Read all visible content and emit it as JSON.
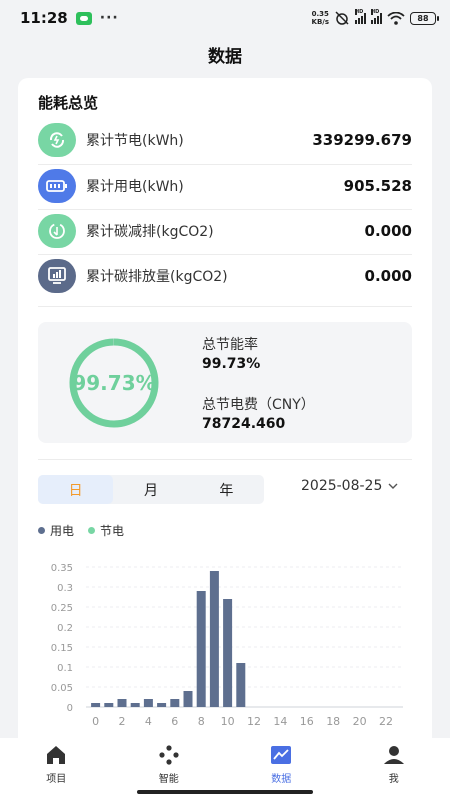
{
  "status_bar": {
    "time": "11:28",
    "more": "···",
    "net_speed_value": "0.35",
    "net_speed_unit": "KB/s",
    "signal_tag": "HD",
    "battery": "88"
  },
  "page_title": "数据",
  "overview": {
    "title": "能耗总览",
    "metrics": [
      {
        "label": "累计节电(kWh)",
        "value": "339299.679",
        "icon": "energy-save-icon",
        "color": "#78d6a4"
      },
      {
        "label": "累计用电(kWh)",
        "value": "905.528",
        "icon": "battery-icon",
        "color": "#4f7ae8"
      },
      {
        "label": "累计碳减排(kgCO2)",
        "value": "0.000",
        "icon": "carbon-reduce-icon",
        "color": "#78d6a4"
      },
      {
        "label": "累计碳排放量(kgCO2)",
        "value": "0.000",
        "icon": "carbon-emission-icon",
        "color": "#5b6a8a"
      }
    ]
  },
  "summary": {
    "ring_value": 0.9973,
    "ring_text": "99.73%",
    "ring_color": "#6fd09c",
    "saving_rate_label": "总节能率",
    "saving_rate_value": "99.73%",
    "saving_fee_label": "总节电费（CNY）",
    "saving_fee_value": "78724.460"
  },
  "period_tabs": [
    {
      "label": "日",
      "active": true
    },
    {
      "label": "月",
      "active": false
    },
    {
      "label": "年",
      "active": false
    }
  ],
  "date": "2025-08-25",
  "legend": [
    {
      "label": "用电",
      "color": "#5e6f8f"
    },
    {
      "label": "节电",
      "color": "#78d6a4"
    }
  ],
  "chart_data": {
    "type": "bar",
    "xlabel": "",
    "ylabel": "",
    "ylim": [
      0,
      0.35
    ],
    "y_ticks": [
      "0",
      "0.05",
      "0.1",
      "0.15",
      "0.2",
      "0.25",
      "0.3",
      "0.35"
    ],
    "x_ticks": [
      "0",
      "2",
      "4",
      "6",
      "8",
      "10",
      "12",
      "14",
      "16",
      "18",
      "20",
      "22"
    ],
    "categories": [
      0,
      1,
      2,
      3,
      4,
      5,
      6,
      7,
      8,
      9,
      10,
      11,
      12,
      13,
      14,
      15,
      16,
      17,
      18,
      19,
      20,
      21,
      22,
      23
    ],
    "series": [
      {
        "name": "用电",
        "color": "#5e6f8f",
        "values": [
          0.01,
          0.01,
          0.02,
          0.01,
          0.02,
          0.01,
          0.02,
          0.04,
          0.29,
          0.34,
          0.27,
          0.11,
          0,
          0,
          0,
          0,
          0,
          0,
          0,
          0,
          0,
          0,
          0,
          0
        ]
      }
    ]
  },
  "bottom_nav": [
    {
      "label": "项目",
      "icon": "home-icon",
      "active": false
    },
    {
      "label": "智能",
      "icon": "smart-icon",
      "active": false
    },
    {
      "label": "数据",
      "icon": "chart-icon",
      "active": true
    },
    {
      "label": "我",
      "icon": "user-icon",
      "active": false
    }
  ]
}
